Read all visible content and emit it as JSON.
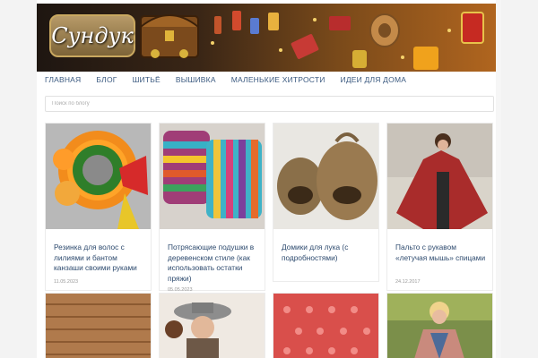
{
  "banner": {
    "logo_text": "Сундук"
  },
  "nav": [
    {
      "label": "ГЛАВНАЯ"
    },
    {
      "label": "БЛОГ"
    },
    {
      "label": "ШИТЬЁ"
    },
    {
      "label": "ВЫШИВКА"
    },
    {
      "label": "МАЛЕНЬКИЕ ХИТРОСТИ"
    },
    {
      "label": "ИДЕИ ДЛЯ ДОМА"
    }
  ],
  "search": {
    "placeholder": "Поиск по блогу"
  },
  "posts": [
    {
      "title": "Резинка для волос с лилиями и бантом канзаши своими руками",
      "date": "11.05.2023"
    },
    {
      "title": "Потрясающие подушки в деревенском стиле (как использовать остатки пряжи)",
      "date": "05.05.2023"
    },
    {
      "title": "Домики для лука (с подробностями)",
      "date": ""
    },
    {
      "title": "Пальто с рукавом «летучая мышь» спицами",
      "date": "24.12.2017"
    },
    {
      "title": "",
      "date": ""
    },
    {
      "title": "",
      "date": ""
    },
    {
      "title": "",
      "date": ""
    },
    {
      "title": "",
      "date": ""
    }
  ]
}
